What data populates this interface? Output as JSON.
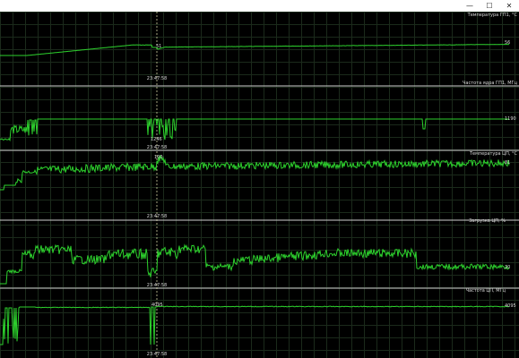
{
  "window": {
    "controls": {
      "minimize_icon": "minimize-icon",
      "maximize_icon": "maximize-icon",
      "close_icon": "close-icon",
      "minimize_glyph": "—",
      "maximize_glyph": "☐",
      "close_glyph": "✕"
    }
  },
  "cursor": {
    "time": "23:47:58"
  },
  "colors": {
    "trace": "#2dd12d",
    "grid": "#1b2a1b",
    "background": "#000000",
    "divider": "#cfcfcf",
    "cursor": "#cfcfa0"
  },
  "graphs": [
    {
      "title": "Температура ГП1, °C",
      "cursor_value": "51",
      "right_value": "56"
    },
    {
      "title": "Частота ядра ГП1, МГц",
      "cursor_value": "1246",
      "right_value": "1190"
    },
    {
      "title": "Температура ЦП, °C",
      "cursor_value": "100",
      "right_value": "81"
    },
    {
      "title": "Загрузка ЦП, %",
      "cursor_value": "",
      "right_value": "20"
    },
    {
      "title": "Частота ЦП, МГц",
      "cursor_value": "4095",
      "right_value": "4095"
    }
  ]
}
